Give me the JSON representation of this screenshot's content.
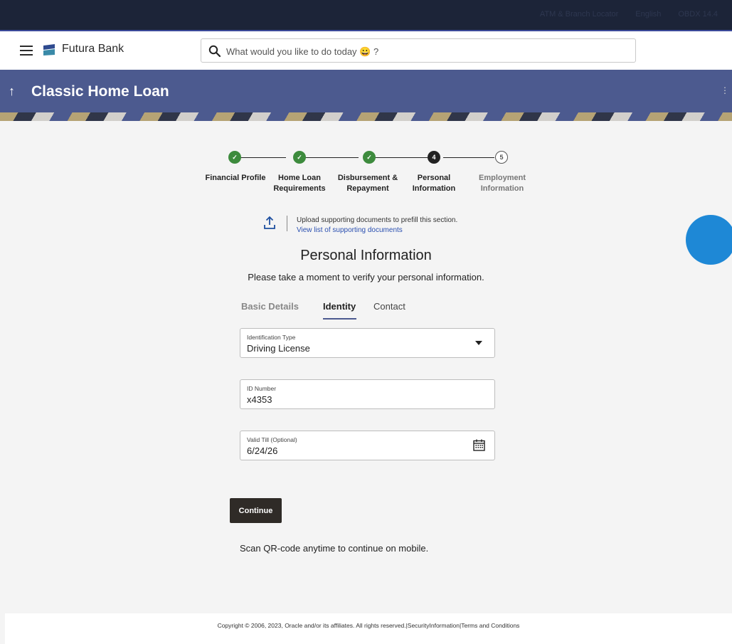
{
  "topbar": {
    "links": [
      "ATM & Branch Locator",
      "English",
      "OBDX 14.4"
    ]
  },
  "header": {
    "brand": "Futura Bank",
    "search_placeholder": "What would you like to do today 😀 ?"
  },
  "banner": {
    "title": "Classic Home Loan",
    "back_glyph": "↑",
    "menu_glyph": "⋮"
  },
  "stepper": {
    "steps": [
      {
        "label_line1": "Financial Profile",
        "label_line2": "",
        "status": "done",
        "marker": "✓"
      },
      {
        "label_line1": "Home Loan",
        "label_line2": "Requirements",
        "status": "done",
        "marker": "✓"
      },
      {
        "label_line1": "Disbursement &",
        "label_line2": "Repayment",
        "status": "done",
        "marker": "✓"
      },
      {
        "label_line1": "Personal",
        "label_line2": "Information",
        "status": "current",
        "marker": "4"
      },
      {
        "label_line1": "Employment",
        "label_line2": "Information",
        "status": "todo",
        "marker": "5"
      }
    ]
  },
  "upload": {
    "text": "Upload supporting documents to prefill this section.",
    "link": "View list of supporting documents"
  },
  "section": {
    "title": "Personal Information",
    "subtitle": "Please take a moment to verify your personal information."
  },
  "tabs": {
    "basic": "Basic Details",
    "identity": "Identity",
    "contact": "Contact",
    "active": "identity"
  },
  "form": {
    "id_type_label": "Identification Type",
    "id_type_value": "Driving License",
    "id_number_label": "ID Number",
    "id_number_value": "x4353",
    "valid_till_label": "Valid Till (Optional)",
    "valid_till_value": "6/24/26"
  },
  "actions": {
    "continue_label": "Continue"
  },
  "qr_text": "Scan QR-code anytime to continue on mobile.",
  "footer": {
    "copyright": "Copyright © 2006, 2023, Oracle and/or its affiliates. All rights reserved.|SecurityInformation|Terms and Conditions"
  },
  "colors": {
    "banner": "#4c5a8f",
    "step_done": "#3d8b3d",
    "topbar": "#1c2438",
    "button": "#2f2b27"
  }
}
